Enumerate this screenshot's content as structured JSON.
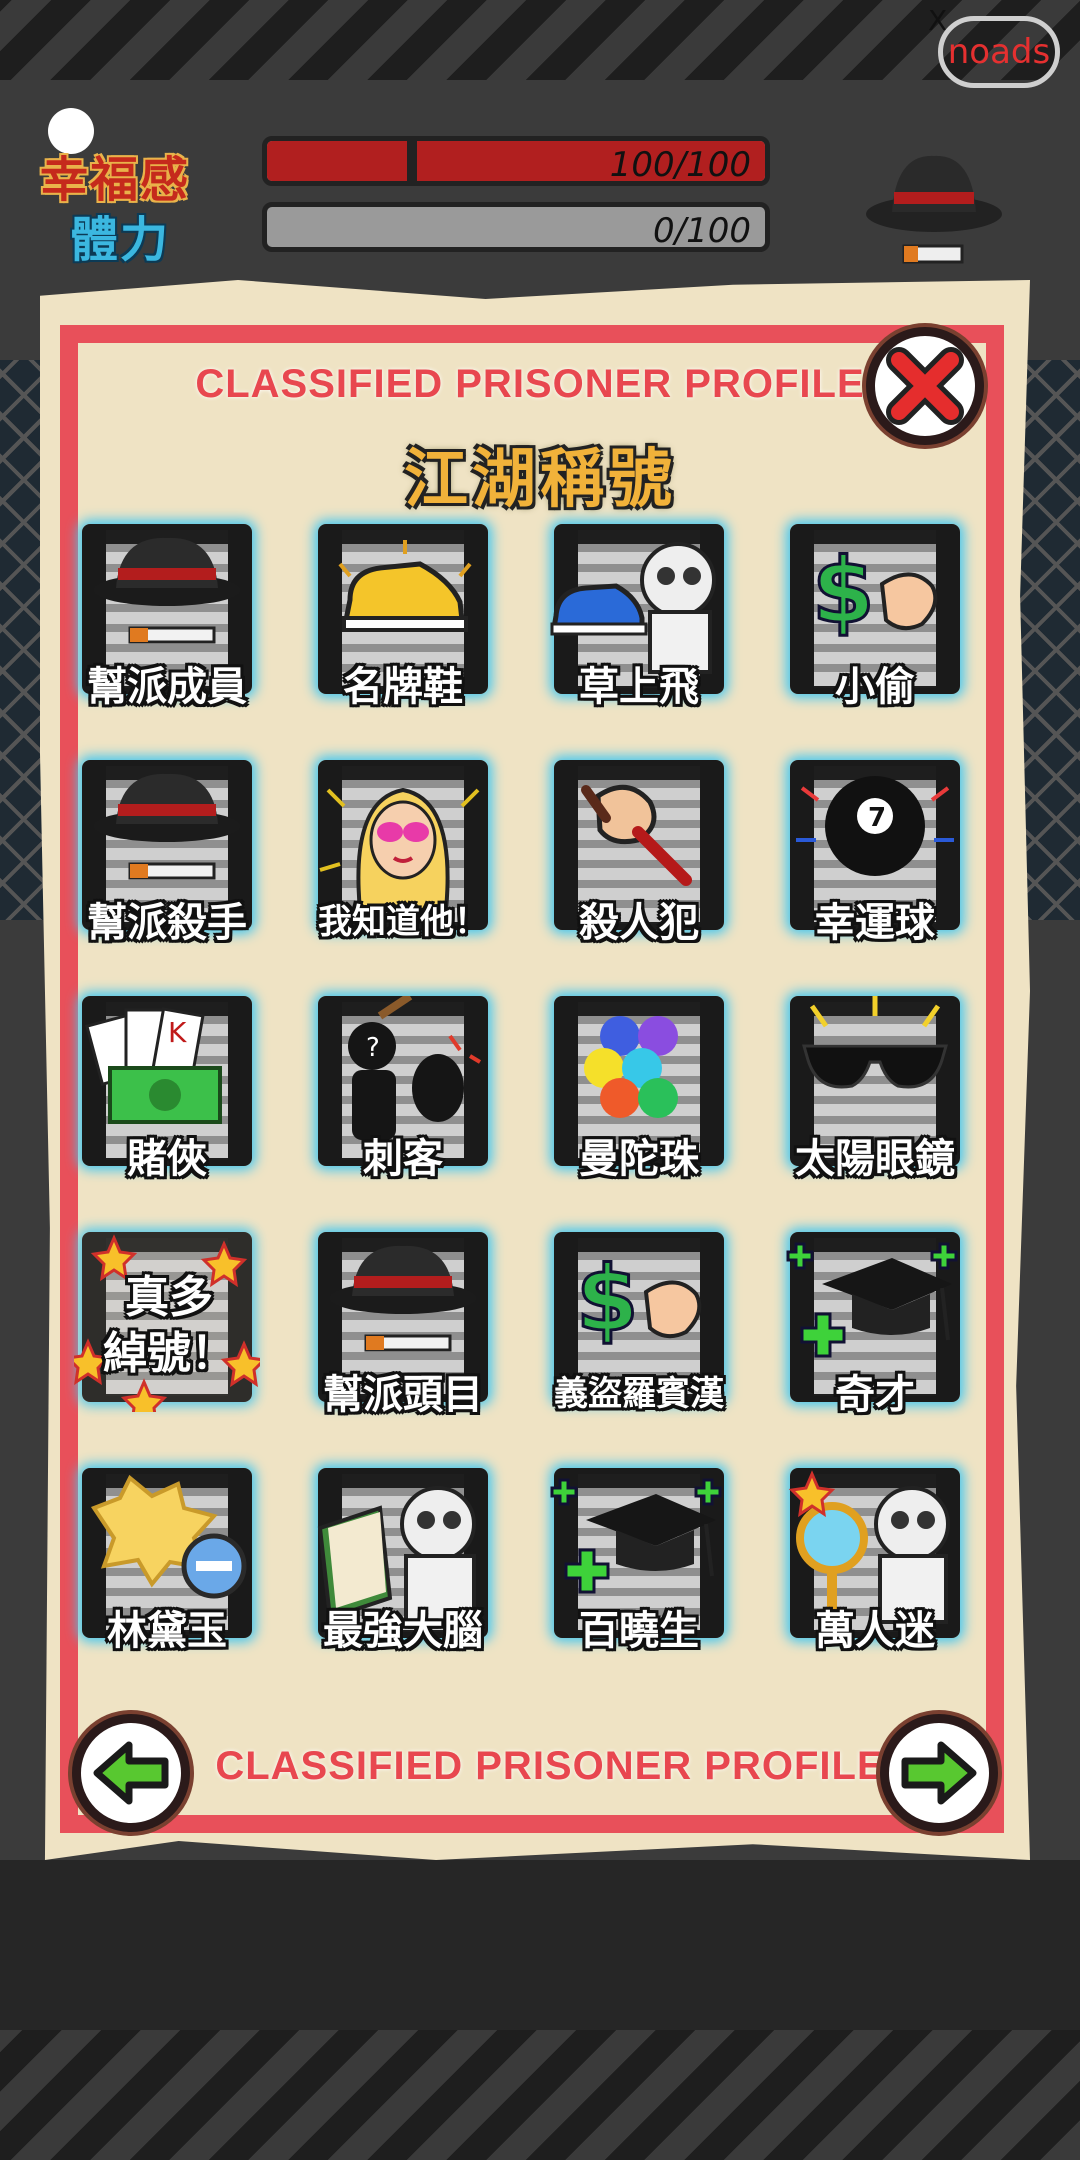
{
  "hud": {
    "happiness_label": "幸福感",
    "stamina_label": "體力",
    "happiness_value": "100/100",
    "happiness_fill": 1.0,
    "stamina_value": "0/100",
    "stamina_fill": 0.0,
    "noads_label": "noads",
    "close_ad_label": "X",
    "happiness_color": "#b11f1f"
  },
  "profile": {
    "banner_top": "CLASSIFIED PRISONER PROFILE",
    "banner_bottom": "CLASSIFIED PRISONER PROFILE",
    "title": "江湖稱號",
    "accent_color": "#e8505a",
    "titles": [
      {
        "label": "幫派成員",
        "icon": "fedora-cigarette-icon"
      },
      {
        "label": "名牌鞋",
        "icon": "gold-sneaker-icon"
      },
      {
        "label": "草上飛",
        "icon": "blue-sneaker-old-man-icon"
      },
      {
        "label": "小偷",
        "icon": "dollar-hand-icon"
      },
      {
        "label": "幫派殺手",
        "icon": "fedora-cigarette-icon"
      },
      {
        "label": "我知道他！",
        "icon": "blonde-woman-icon"
      },
      {
        "label": "殺人犯",
        "icon": "fist-knife-icon"
      },
      {
        "label": "幸運球",
        "icon": "eight-ball-icon"
      },
      {
        "label": "賭俠",
        "icon": "cards-cash-icon"
      },
      {
        "label": "刺客",
        "icon": "assassin-silhouette-icon"
      },
      {
        "label": "曼陀珠",
        "icon": "candy-balls-icon"
      },
      {
        "label": "太陽眼鏡",
        "icon": "sunglasses-icon"
      },
      {
        "label": "真多\n綽號！",
        "icon": "star-burst-icon"
      },
      {
        "label": "幫派頭目",
        "icon": "fedora-cigarette-icon"
      },
      {
        "label": "義盜羅賓漢",
        "icon": "dollar-hand-icon"
      },
      {
        "label": "奇才",
        "icon": "grad-cap-plus-icon"
      },
      {
        "label": "林黛玉",
        "icon": "explosion-minus-icon"
      },
      {
        "label": "最強大腦",
        "icon": "book-old-man-icon"
      },
      {
        "label": "百曉生",
        "icon": "grad-cap-plus-icon"
      },
      {
        "label": "萬人迷",
        "icon": "mirror-old-man-icon"
      }
    ]
  }
}
